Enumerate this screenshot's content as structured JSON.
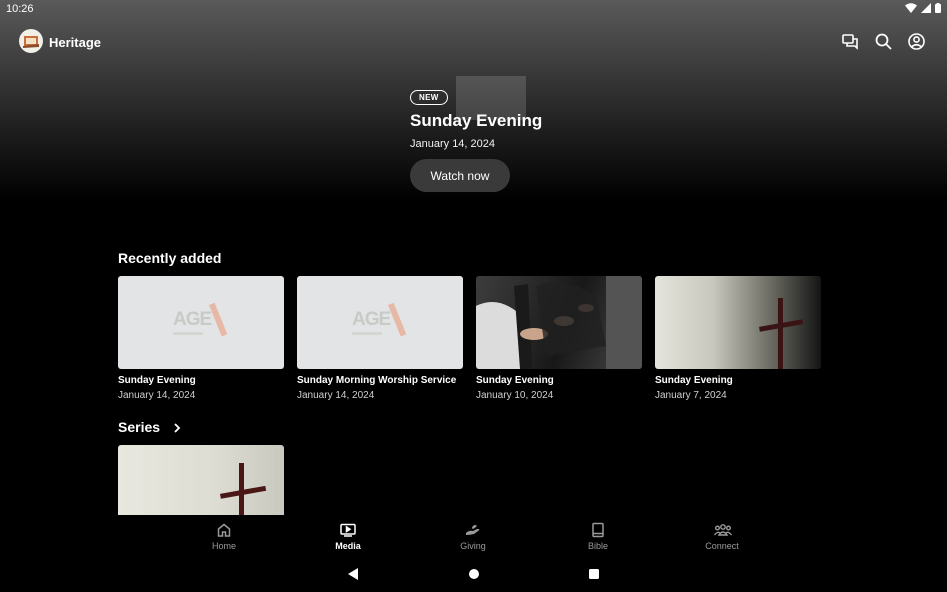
{
  "status_bar": {
    "time": "10:26"
  },
  "app": {
    "name": "Heritage"
  },
  "hero": {
    "badge": "NEW",
    "title": "Sunday Evening",
    "date": "January 14, 2024",
    "watch_label": "Watch now"
  },
  "recently_added": {
    "title": "Recently added",
    "items": [
      {
        "title": "Sunday Evening",
        "date": "January 14, 2024"
      },
      {
        "title": "Sunday Morning Worship Service",
        "date": "January 14, 2024"
      },
      {
        "title": "Sunday Evening",
        "date": "January 10, 2024"
      },
      {
        "title": "Sunday Evening",
        "date": "January 7, 2024"
      }
    ]
  },
  "series": {
    "title": "Series"
  },
  "thumb_logo": {
    "text": "AGE"
  },
  "nav": {
    "items": [
      {
        "label": "Home",
        "icon": "home-icon"
      },
      {
        "label": "Media",
        "icon": "media-icon",
        "active": true
      },
      {
        "label": "Giving",
        "icon": "giving-icon"
      },
      {
        "label": "Bible",
        "icon": "bible-icon"
      },
      {
        "label": "Connect",
        "icon": "connect-icon"
      }
    ]
  },
  "colors": {
    "background": "#000000",
    "button": "#3a3a3a",
    "inactive_nav": "#9a9a9a"
  }
}
